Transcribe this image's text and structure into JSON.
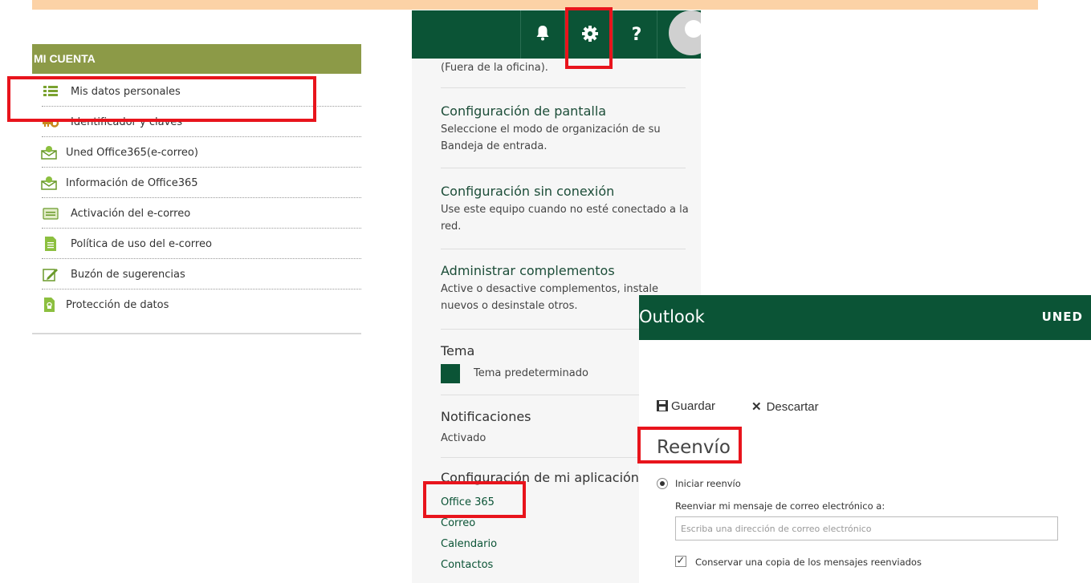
{
  "account_menu": {
    "header": "MI CUENTA",
    "items": [
      {
        "label": "Mis datos personales",
        "icon": "list-icon"
      },
      {
        "label": "Identificador y claves",
        "icon": "key-icon"
      },
      {
        "label": "Uned Office365(e-correo)",
        "icon": "mail-icon"
      },
      {
        "label": "Información de Office365",
        "icon": "mail-icon"
      },
      {
        "label": "Activación del e-correo",
        "icon": "card-icon"
      },
      {
        "label": "Política de uso del e-correo",
        "icon": "document-icon"
      },
      {
        "label": "Buzón de sugerencias",
        "icon": "pencil-icon"
      },
      {
        "label": "Protección de datos",
        "icon": "lock-document-icon"
      }
    ]
  },
  "settings_panel": {
    "toolbar": {
      "bell": "bell-icon",
      "gear": "gear-icon",
      "help": "?"
    },
    "out_of_office_tail": "(Fuera de la oficina).",
    "display": {
      "title": "Configuración de pantalla",
      "desc1": "Seleccione el modo de organización de su",
      "desc2": "Bandeja de entrada."
    },
    "offline": {
      "title": "Configuración sin conexión",
      "desc1": "Use este equipo cuando no esté conectado a la",
      "desc2": "red."
    },
    "addins": {
      "title": "Administrar complementos",
      "desc1": "Active o desactive complementos, instale",
      "desc2": "nuevos o desinstale otros."
    },
    "theme": {
      "title": "Tema",
      "value": "Tema predeterminado",
      "color": "#0b5436"
    },
    "notifications": {
      "title": "Notificaciones",
      "value": "Activado"
    },
    "my_app": {
      "title": "Configuración de mi aplicación",
      "links": [
        "Office 365",
        "Correo",
        "Calendario",
        "Contactos"
      ]
    }
  },
  "outlook_panel": {
    "title": "Outlook",
    "logo": "UNED",
    "save": "Guardar",
    "discard": "Descartar",
    "heading": "Reenvío",
    "radio_label": "Iniciar reenvío",
    "forward_label": "Reenviar mi mensaje de correo electrónico a:",
    "input_placeholder": "Escriba una dirección de correo electrónico",
    "keep_copy_label": "Conservar una copia de los mensajes reenviados"
  },
  "colors": {
    "brand_green": "#0b5436",
    "menu_header": "#8c9a47",
    "highlight": "#e8141c",
    "top_strip": "#fcd2a6"
  }
}
